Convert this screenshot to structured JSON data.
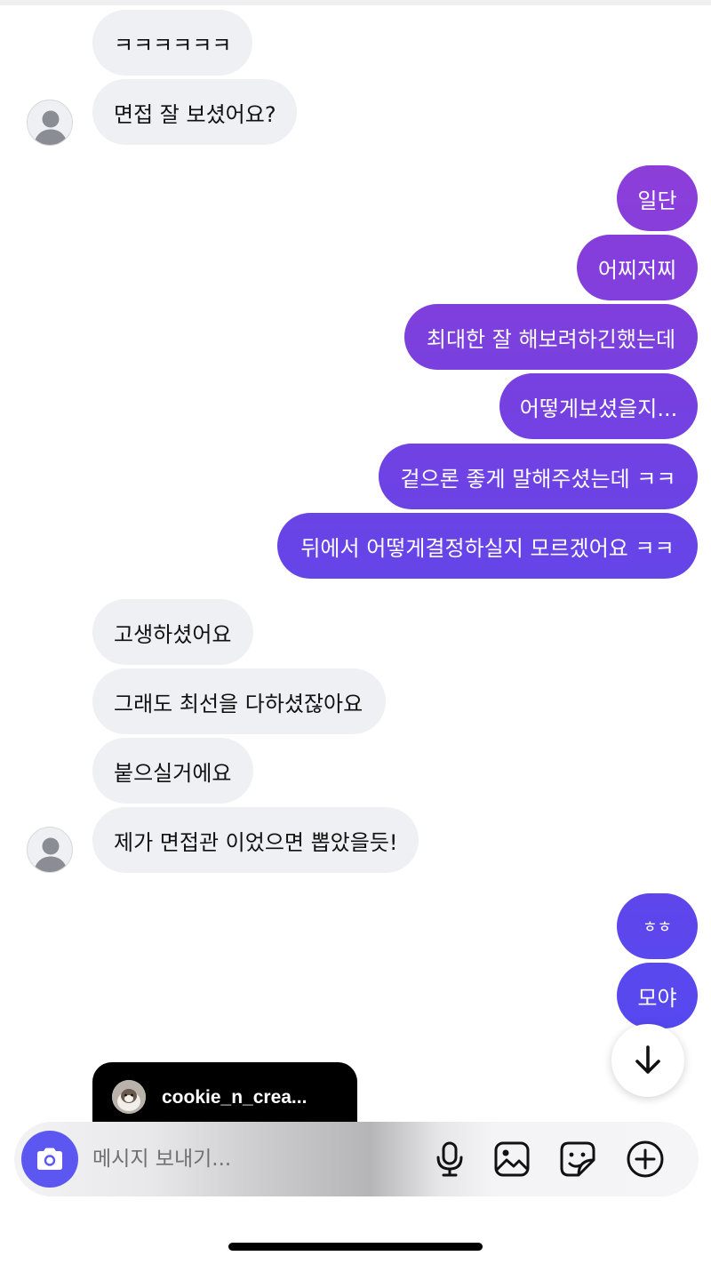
{
  "thread": {
    "incoming_group_1": [
      {
        "text": "ㅋㅋㅋㅋㅋㅋ"
      },
      {
        "text": "면접 잘 보셨어요?"
      }
    ],
    "outgoing_group_1": [
      {
        "text": "일단"
      },
      {
        "text": "어찌저찌"
      },
      {
        "text": "최대한 잘 해보려하긴했는데"
      },
      {
        "text": "어떻게보셨을지..."
      },
      {
        "text": "겉으론 좋게 말해주셨는데 ㅋㅋ"
      },
      {
        "text": "뒤에서 어떻게결정하실지 모르겠어요 ㅋㅋ"
      }
    ],
    "incoming_group_2": [
      {
        "text": "고생하셨어요"
      },
      {
        "text": "그래도 최선을 다하셨잖아요"
      },
      {
        "text": "붙으실거에요"
      },
      {
        "text": "제가 면접관 이었으면 뽑았을듯!"
      }
    ],
    "outgoing_group_2": [
      {
        "text": "ㅎㅎ"
      },
      {
        "text": "모야"
      }
    ]
  },
  "story_preview": {
    "username": "cookie_n_crea..."
  },
  "composer": {
    "placeholder": "메시지 보내기..."
  },
  "colors": {
    "incoming_bubble": "#eff0f4",
    "outgoing_gradient_top": "#8d3ed9",
    "outgoing_gradient_bottom": "#5948ee",
    "camera_button": "#5b57f0"
  },
  "icons": {
    "scroll_down": "arrow-down-icon",
    "camera": "camera-icon",
    "microphone": "microphone-icon",
    "gallery": "image-icon",
    "sticker": "sticker-icon",
    "more": "plus-circle-icon"
  }
}
